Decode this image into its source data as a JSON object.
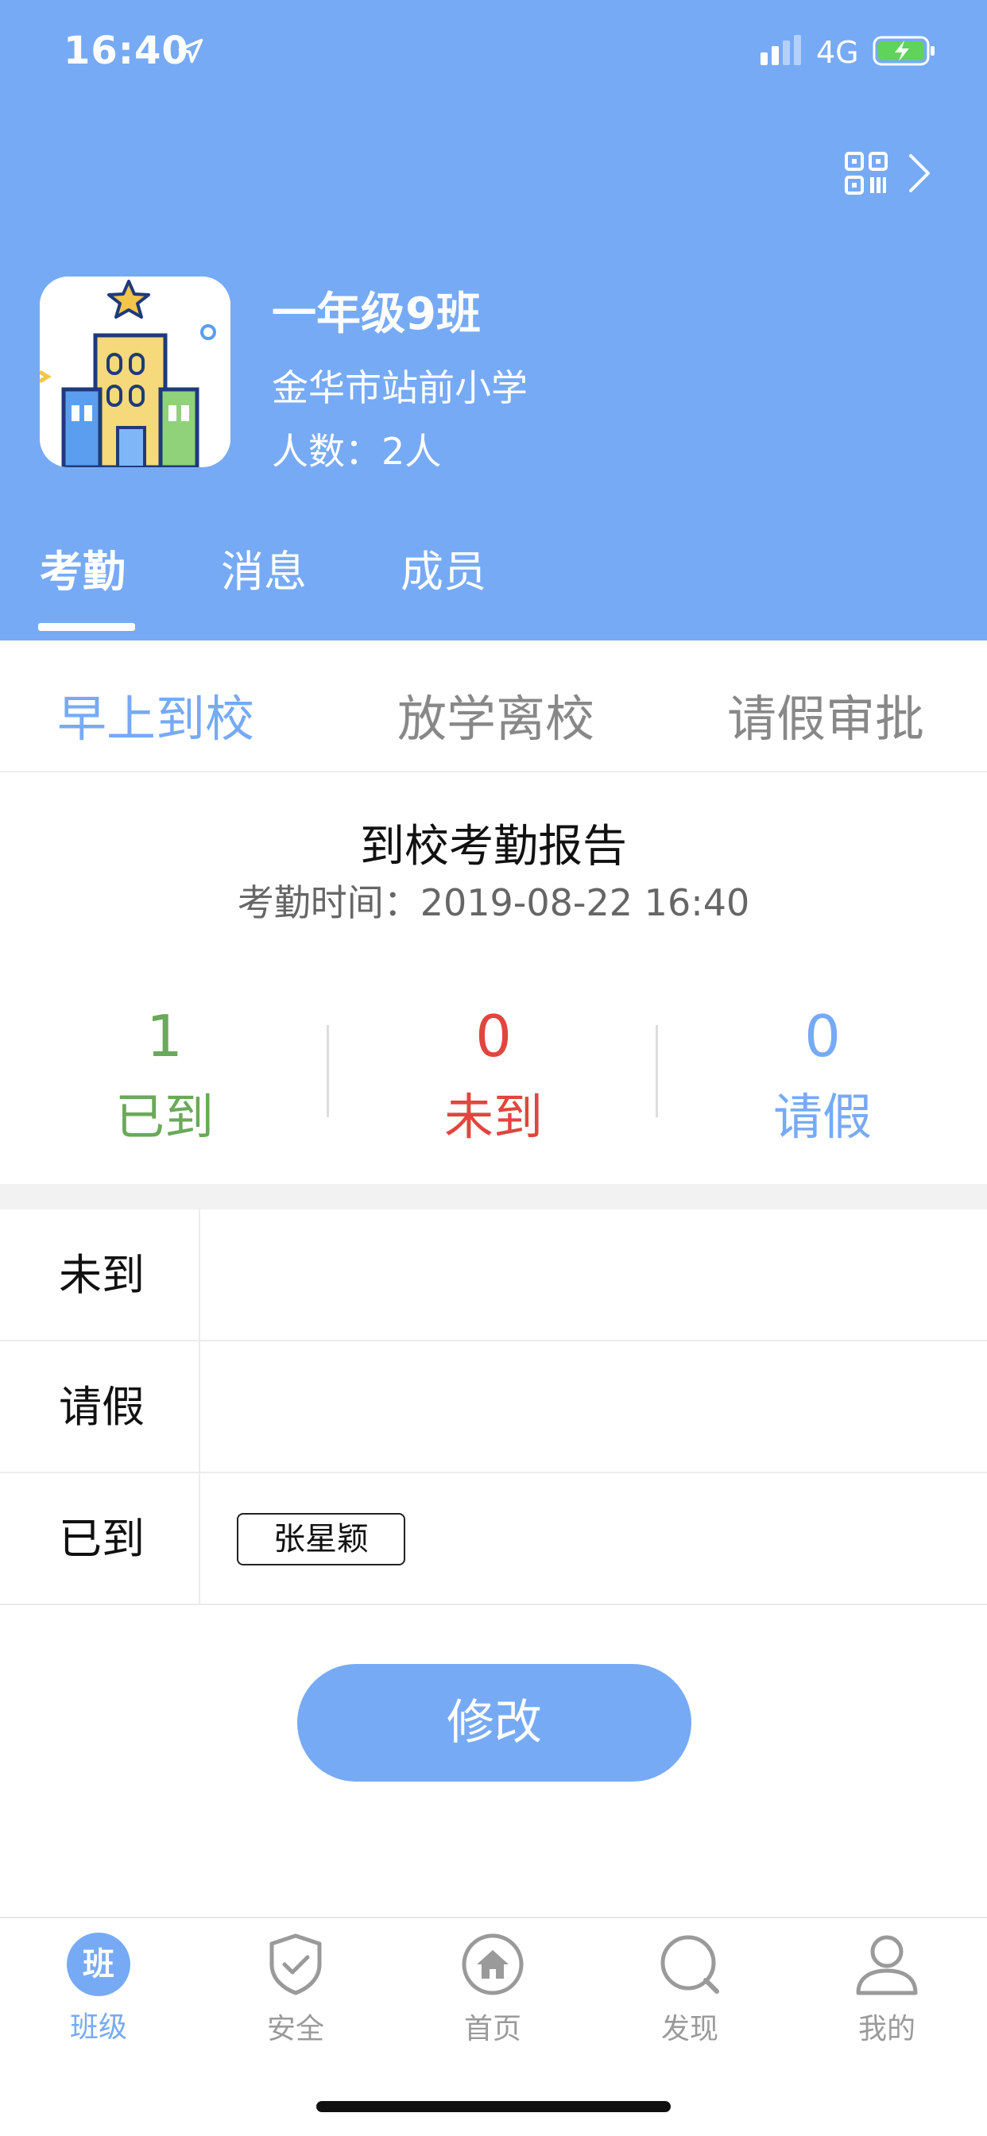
{
  "status_bar": {
    "time": "16:40",
    "network": "4G"
  },
  "class_info": {
    "name": "一年级9班",
    "school": "金华市站前小学",
    "member_count": "人数：2人"
  },
  "main_tabs": [
    {
      "label": "考勤"
    },
    {
      "label": "消息"
    },
    {
      "label": "成员"
    }
  ],
  "sub_tabs": [
    {
      "label": "早上到校"
    },
    {
      "label": "放学离校"
    },
    {
      "label": "请假审批"
    }
  ],
  "report": {
    "title": "到校考勤报告",
    "time": "考勤时间：2019-08-22 16:40",
    "stats": [
      {
        "value": "1",
        "label": "已到"
      },
      {
        "value": "0",
        "label": "未到"
      },
      {
        "value": "0",
        "label": "请假"
      }
    ]
  },
  "lists": [
    {
      "label": "未到",
      "names": []
    },
    {
      "label": "请假",
      "names": []
    },
    {
      "label": "已到",
      "names": [
        "张星颖"
      ]
    }
  ],
  "actions": {
    "modify_label": "修改"
  },
  "bottom_nav": [
    {
      "label": "班级",
      "badge": "班",
      "icon": "class-icon"
    },
    {
      "label": "安全",
      "icon": "shield-icon"
    },
    {
      "label": "首页",
      "icon": "home-icon"
    },
    {
      "label": "发现",
      "icon": "discover-icon"
    },
    {
      "label": "我的",
      "icon": "profile-icon"
    }
  ],
  "colors": {
    "primary": "#77aaf5",
    "present": "#6aa95a",
    "absent": "#e0463f",
    "leave": "#77aaf5"
  }
}
